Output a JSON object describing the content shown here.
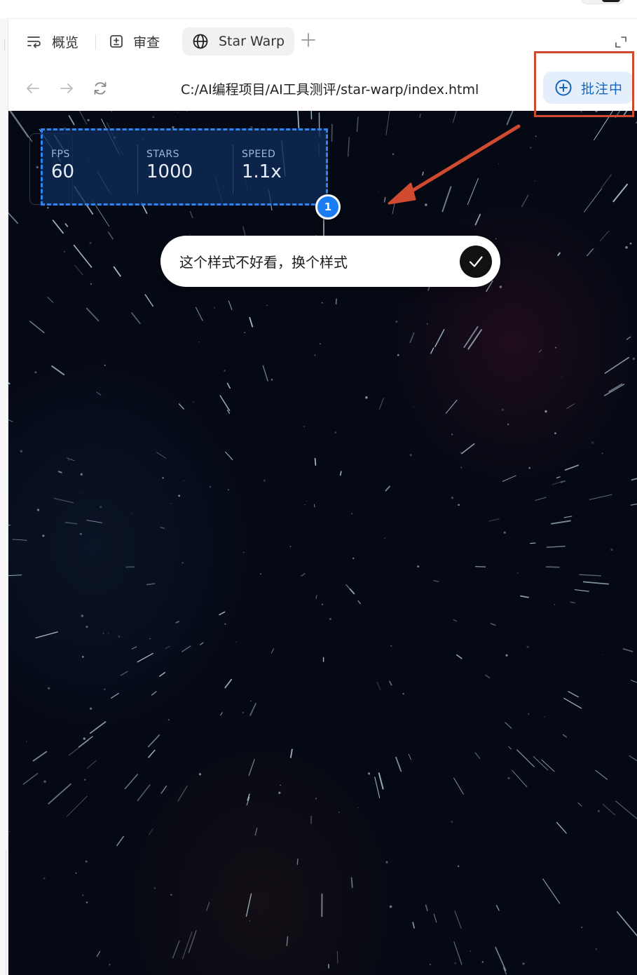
{
  "tabs": {
    "overview": {
      "label": "概览",
      "icon": "overview-icon"
    },
    "review": {
      "label": "审查",
      "icon": "review-icon"
    },
    "active": {
      "label": "Star Warp",
      "icon": "globe-icon"
    },
    "add_icon": "plus-icon",
    "expand_icon": "expand-icon"
  },
  "address": {
    "url": "C:/AI编程项目/AI工具测评/star-warp/index.html",
    "annotate_label": "批注中",
    "annotate_icon": "add-circle-icon"
  },
  "stats": {
    "fps": {
      "key": "FPS",
      "value": "60"
    },
    "stars": {
      "key": "STARS",
      "value": "1000"
    },
    "speed": {
      "key": "SPEED",
      "value": "1.1x"
    }
  },
  "annotation": {
    "badge_number": "1",
    "comment": "这个样式不好看，换个样式",
    "confirm_icon": "checkmark-icon"
  },
  "colors": {
    "accent_blue": "#1a7cf0",
    "highlight_red": "#d04a32",
    "viewport_bg": "#050914",
    "annotate_bg": "#e5effb",
    "annotate_text": "#1565c0"
  }
}
